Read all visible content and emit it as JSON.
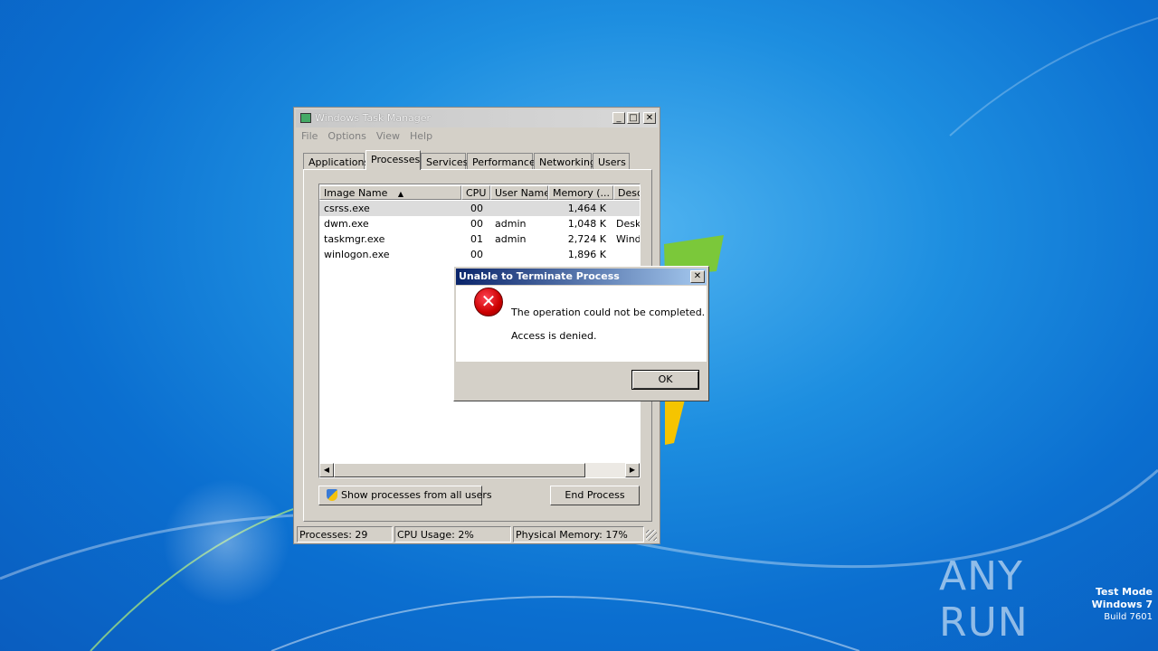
{
  "desktop": {
    "watermark": "ANY RUN",
    "test_mode": "Test Mode",
    "os_name": "Windows 7",
    "build": "Build 7601"
  },
  "task_manager": {
    "title": "Windows Task Manager",
    "menu": [
      "File",
      "Options",
      "View",
      "Help"
    ],
    "tabs": [
      "Applications",
      "Processes",
      "Services",
      "Performance",
      "Networking",
      "Users"
    ],
    "active_tab": "Processes",
    "columns": [
      "Image Name",
      "CPU",
      "User Name",
      "Memory (...",
      "Desc"
    ],
    "rows": [
      {
        "name": "csrss.exe",
        "cpu": "00",
        "user": "",
        "memory": "1,464 K",
        "desc": ""
      },
      {
        "name": "dwm.exe",
        "cpu": "00",
        "user": "admin",
        "memory": "1,048 K",
        "desc": "Desk"
      },
      {
        "name": "taskmgr.exe",
        "cpu": "01",
        "user": "admin",
        "memory": "2,724 K",
        "desc": "Wind"
      },
      {
        "name": "winlogon.exe",
        "cpu": "00",
        "user": "",
        "memory": "1,896 K",
        "desc": ""
      }
    ],
    "show_all_button": "Show processes from all users",
    "end_process_button": "End Process",
    "status": {
      "processes": "Processes: 29",
      "cpu_usage": "CPU Usage: 2%",
      "physical_memory": "Physical Memory: 17%"
    }
  },
  "dialog": {
    "title": "Unable to Terminate Process",
    "message": "The operation could not be completed.",
    "detail": "Access is denied.",
    "ok_label": "OK"
  }
}
